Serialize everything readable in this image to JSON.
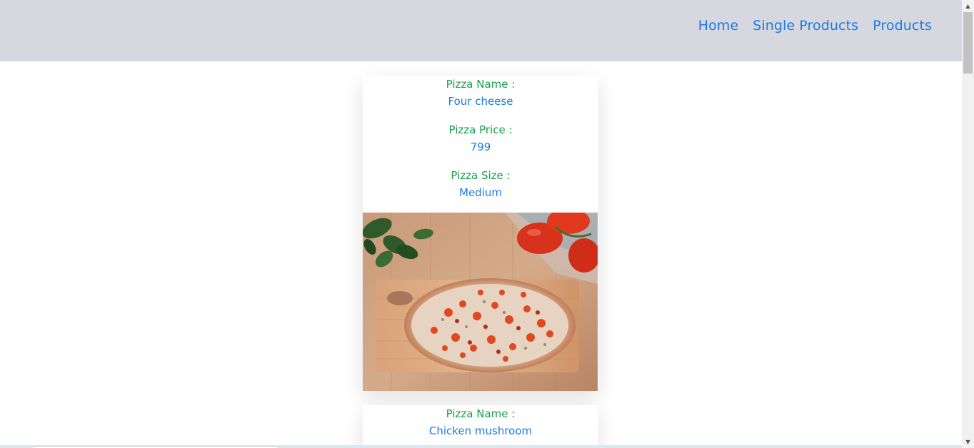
{
  "nav": {
    "links": [
      "Home",
      "Single Products",
      "Products"
    ]
  },
  "cards": [
    {
      "name_label": "Pizza Name :",
      "name_value": "Four cheese",
      "price_label": "Pizza Price :",
      "price_value": "799",
      "size_label": "Pizza Size :",
      "size_value": "Medium",
      "image": "pizza-photo"
    },
    {
      "name_label": "Pizza Name :",
      "name_value": "Chicken mushroom"
    }
  ],
  "colors": {
    "navbar_bg": "#d6d7df",
    "link": "#1a7be6",
    "label_green": "#16a14a"
  },
  "icons": {
    "scroll_up": "chevron-up-icon",
    "scroll_down": "chevron-down-icon"
  }
}
